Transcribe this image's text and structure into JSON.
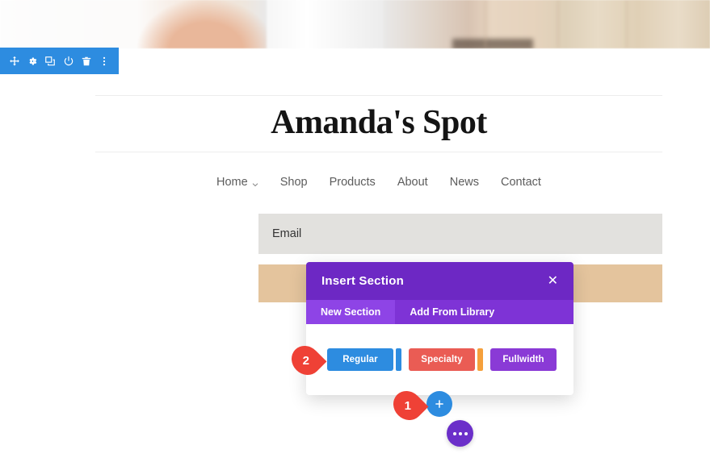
{
  "builder_toolbar": {
    "icons": [
      {
        "name": "move-icon",
        "label": "Move"
      },
      {
        "name": "gear-icon",
        "label": "Settings"
      },
      {
        "name": "duplicate-icon",
        "label": "Duplicate"
      },
      {
        "name": "power-icon",
        "label": "Enable/Disable"
      },
      {
        "name": "trash-icon",
        "label": "Delete"
      },
      {
        "name": "vertical-dots-icon",
        "label": "More Options"
      }
    ],
    "background_color": "#2d8ce0"
  },
  "site": {
    "title": "Amanda's Spot",
    "nav": [
      {
        "label": "Home",
        "has_dropdown": true
      },
      {
        "label": "Shop",
        "has_dropdown": false
      },
      {
        "label": "Products",
        "has_dropdown": false
      },
      {
        "label": "About",
        "has_dropdown": false
      },
      {
        "label": "News",
        "has_dropdown": false
      },
      {
        "label": "Contact",
        "has_dropdown": false
      }
    ],
    "email_band_label": "Email",
    "email_band_color": "#e2e1de",
    "tan_band_color": "#e4c49d"
  },
  "modal": {
    "title": "Insert Section",
    "close_label": "✕",
    "tabs": [
      {
        "label": "New Section",
        "active": true
      },
      {
        "label": "Add From Library",
        "active": false
      }
    ],
    "buttons": [
      {
        "label": "Regular",
        "color": "#2d8ce0"
      },
      {
        "label": "Specialty",
        "color": "#ea5c54"
      },
      {
        "label": "Fullwidth",
        "color": "#8a3ad6"
      }
    ],
    "accents": [
      {
        "name": "blue-accent-bar",
        "color": "#2d8ce0"
      },
      {
        "name": "orange-accent-bar",
        "color": "#f5a03c"
      }
    ],
    "header_color": "#6d28c4",
    "tabbar_color": "#7e33d6",
    "active_tab_color": "#8e44e6"
  },
  "floating": {
    "add_section_label": "+",
    "add_section_color": "#2d8ce0",
    "more_options_color": "#6b2fc9"
  },
  "callouts": [
    {
      "number": "1",
      "color": "#ef4136"
    },
    {
      "number": "2",
      "color": "#ef4136"
    }
  ]
}
